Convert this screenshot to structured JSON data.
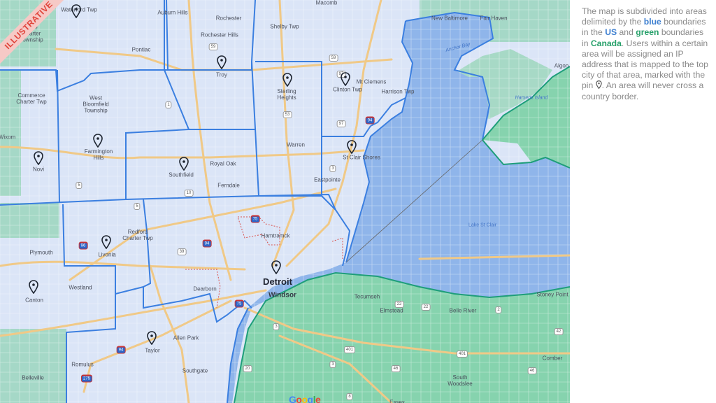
{
  "watermark": "ILLUSTRATIVE",
  "description": {
    "part1": "The map is subdivided into areas delimited by the ",
    "blue_word": "blue",
    "part2": " boundaries in the ",
    "us_word": "US",
    "part3": " and ",
    "green_word": "green",
    "part4": " boundaries in ",
    "canada_word": "Canada",
    "part5": ". Users within a certain area will be assigned an IP address that is mapped to the top city of that area, marked with the pin ",
    "pin_icon": "map-pin-icon",
    "part6": ". An area will never cross a country border."
  },
  "colors": {
    "us_boundary": "#3b7fe0",
    "canada_boundary": "#1e9e7a",
    "water": "#8fb5ea",
    "us_land": "#dbe5f7",
    "canada_land": "#86d3ae",
    "roads": "#f0c987",
    "pin": "#1d2430",
    "text_blue": "#3d7fd0",
    "text_green": "#27a06a"
  },
  "pins": [
    {
      "city": "Waterford Twp"
    },
    {
      "city": "Troy"
    },
    {
      "city": "Sterling Heights"
    },
    {
      "city": "Clinton Twp"
    },
    {
      "city": "Farmington Hills"
    },
    {
      "city": "Novi"
    },
    {
      "city": "Southfield"
    },
    {
      "city": "St Clair Shores"
    },
    {
      "city": "Livonia"
    },
    {
      "city": "Canton"
    },
    {
      "city": "Detroit"
    },
    {
      "city": "Taylor"
    }
  ],
  "labels": {
    "waterford": "Waterford\nTwp",
    "auburn_hills": "Auburn Hills",
    "rochester": "Rochester",
    "rochester_hills": "Rochester Hills",
    "shelby": "Shelby Twp",
    "macomb": "Macomb",
    "new_baltimore": "New Baltimore",
    "fair_haven": "Fair Haven",
    "anchor_bay": "Anchor Bay",
    "algonac": "Algon",
    "lake_charter": "Lake\nCharter\nTownship",
    "pontiac": "Pontiac",
    "troy": "Troy",
    "sterling_heights": "Sterling\nHeights",
    "clinton": "Clinton Twp",
    "mt_clemens": "Mt Clemens",
    "harrison": "Harrison Twp",
    "harsens": "Harsens Island",
    "commerce": "Commerce\nCharter Twp",
    "west_bloomfield": "West\nBloomfield\nTownship",
    "wixom": "Wixom",
    "farmington": "Farmington\nHills",
    "novi": "Novi",
    "southfield": "Southfield",
    "royal_oak": "Royal Oak",
    "ferndale": "Ferndale",
    "warren": "Warren",
    "st_clair_shores": "St Clair Shores",
    "eastpointe": "Eastpointe",
    "lake_st_clair": "Lake St Clair",
    "redford": "Redford\nCharter Twp",
    "plymouth": "Plymouth",
    "livonia": "Livonia",
    "hamtramck": "Hamtramck",
    "westland": "Westland",
    "canton": "Canton",
    "dearborn": "Dearborn",
    "detroit": "Detroit",
    "windsor": "Windsor",
    "tecumseh": "Tecumseh",
    "elmstead": "Elmstead",
    "belle_river": "Belle River",
    "stoney_point": "Stoney Point",
    "allen_park": "Allen Park",
    "taylor": "Taylor",
    "romulus": "Romulus",
    "southgate": "Southgate",
    "belleville": "Belleville",
    "comber": "Comber",
    "south_woodslee": "South\nWoodslee",
    "essex": "Essex",
    "google": "Google"
  },
  "shields": [
    "59",
    "59",
    "53",
    "97",
    "97",
    "94",
    "5",
    "5",
    "10",
    "3",
    "1",
    "96",
    "39",
    "94",
    "75",
    "75",
    "94",
    "275",
    "401",
    "401",
    "3",
    "22",
    "22",
    "2",
    "42",
    "46",
    "46",
    "8",
    "3",
    "20"
  ]
}
